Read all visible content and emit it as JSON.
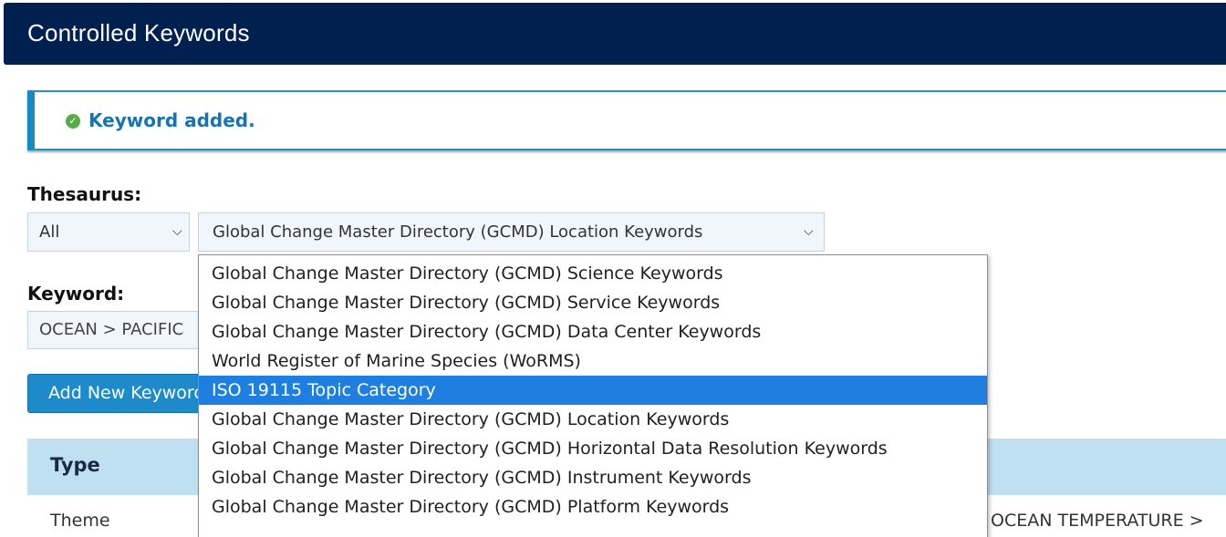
{
  "header": {
    "title": "Controlled Keywords"
  },
  "alert": {
    "icon": "check-circle-icon",
    "message": "Keyword added."
  },
  "form": {
    "thesaurus_label": "Thesaurus:",
    "filter_select_value": "All",
    "thesaurus_select_value": "Global Change Master Directory (GCMD) Location Keywords",
    "keyword_label": "Keyword:",
    "keyword_value": "OCEAN > PACIFIC",
    "add_button_label": "Add New Keyword"
  },
  "dropdown": {
    "options": [
      "Global Change Master Directory (GCMD) Science Keywords",
      "Global Change Master Directory (GCMD) Service Keywords",
      "Global Change Master Directory (GCMD) Data Center Keywords",
      "World Register of Marine Species (WoRMS)",
      "ISO 19115 Topic Category",
      "Global Change Master Directory (GCMD) Location Keywords",
      "Global Change Master Directory (GCMD) Horizontal Data Resolution Keywords",
      "Global Change Master Directory (GCMD) Instrument Keywords",
      "Global Change Master Directory (GCMD) Platform Keywords"
    ],
    "highlighted_option": "ISO 19115 Topic Category"
  },
  "table": {
    "header_type": "Type",
    "first_row_type": "Theme",
    "first_row_keyword_partial": "OCEAN TEMPERATURE >"
  },
  "colors": {
    "header_bg": "#00204f",
    "alert_border": "#1789c6",
    "alert_text": "#1673b6",
    "button_bg": "#1d8bcb",
    "table_header_bg": "#bfe0f0",
    "dropdown_highlight": "#1e7fe0"
  }
}
